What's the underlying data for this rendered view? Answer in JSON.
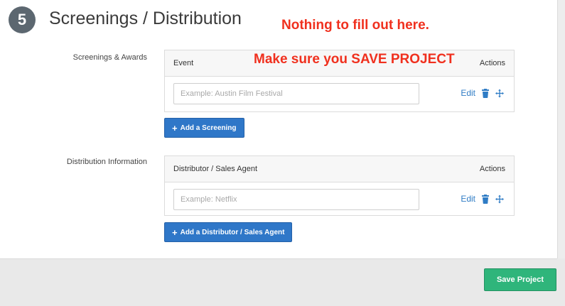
{
  "section": {
    "step_number": "5",
    "title": "Screenings / Distribution"
  },
  "annotations": {
    "note_top": "Nothing to fill out here.",
    "note_save": "Make sure you SAVE PROJECT"
  },
  "screenings": {
    "label": "Screenings & Awards",
    "column_event": "Event",
    "column_actions": "Actions",
    "input_placeholder": "Example: Austin Film Festival",
    "input_value": "",
    "edit_label": "Edit",
    "add_button_label": "Add a Screening"
  },
  "distribution": {
    "label": "Distribution Information",
    "column_distributor": "Distributor / Sales Agent",
    "column_actions": "Actions",
    "input_placeholder": "Example: Netflix",
    "input_value": "",
    "edit_label": "Edit",
    "add_button_label": "Add a Distributor / Sales Agent"
  },
  "footer": {
    "save_label": "Save Project"
  },
  "colors": {
    "annotation_red": "#f0301e",
    "primary_blue": "#2f77c8",
    "link_blue": "#2f7cc5",
    "save_green": "#2fb57b",
    "badge_gray": "#5c6770"
  },
  "icons": {
    "plus": "plus-icon",
    "trash": "trash-icon",
    "move": "move-icon"
  }
}
